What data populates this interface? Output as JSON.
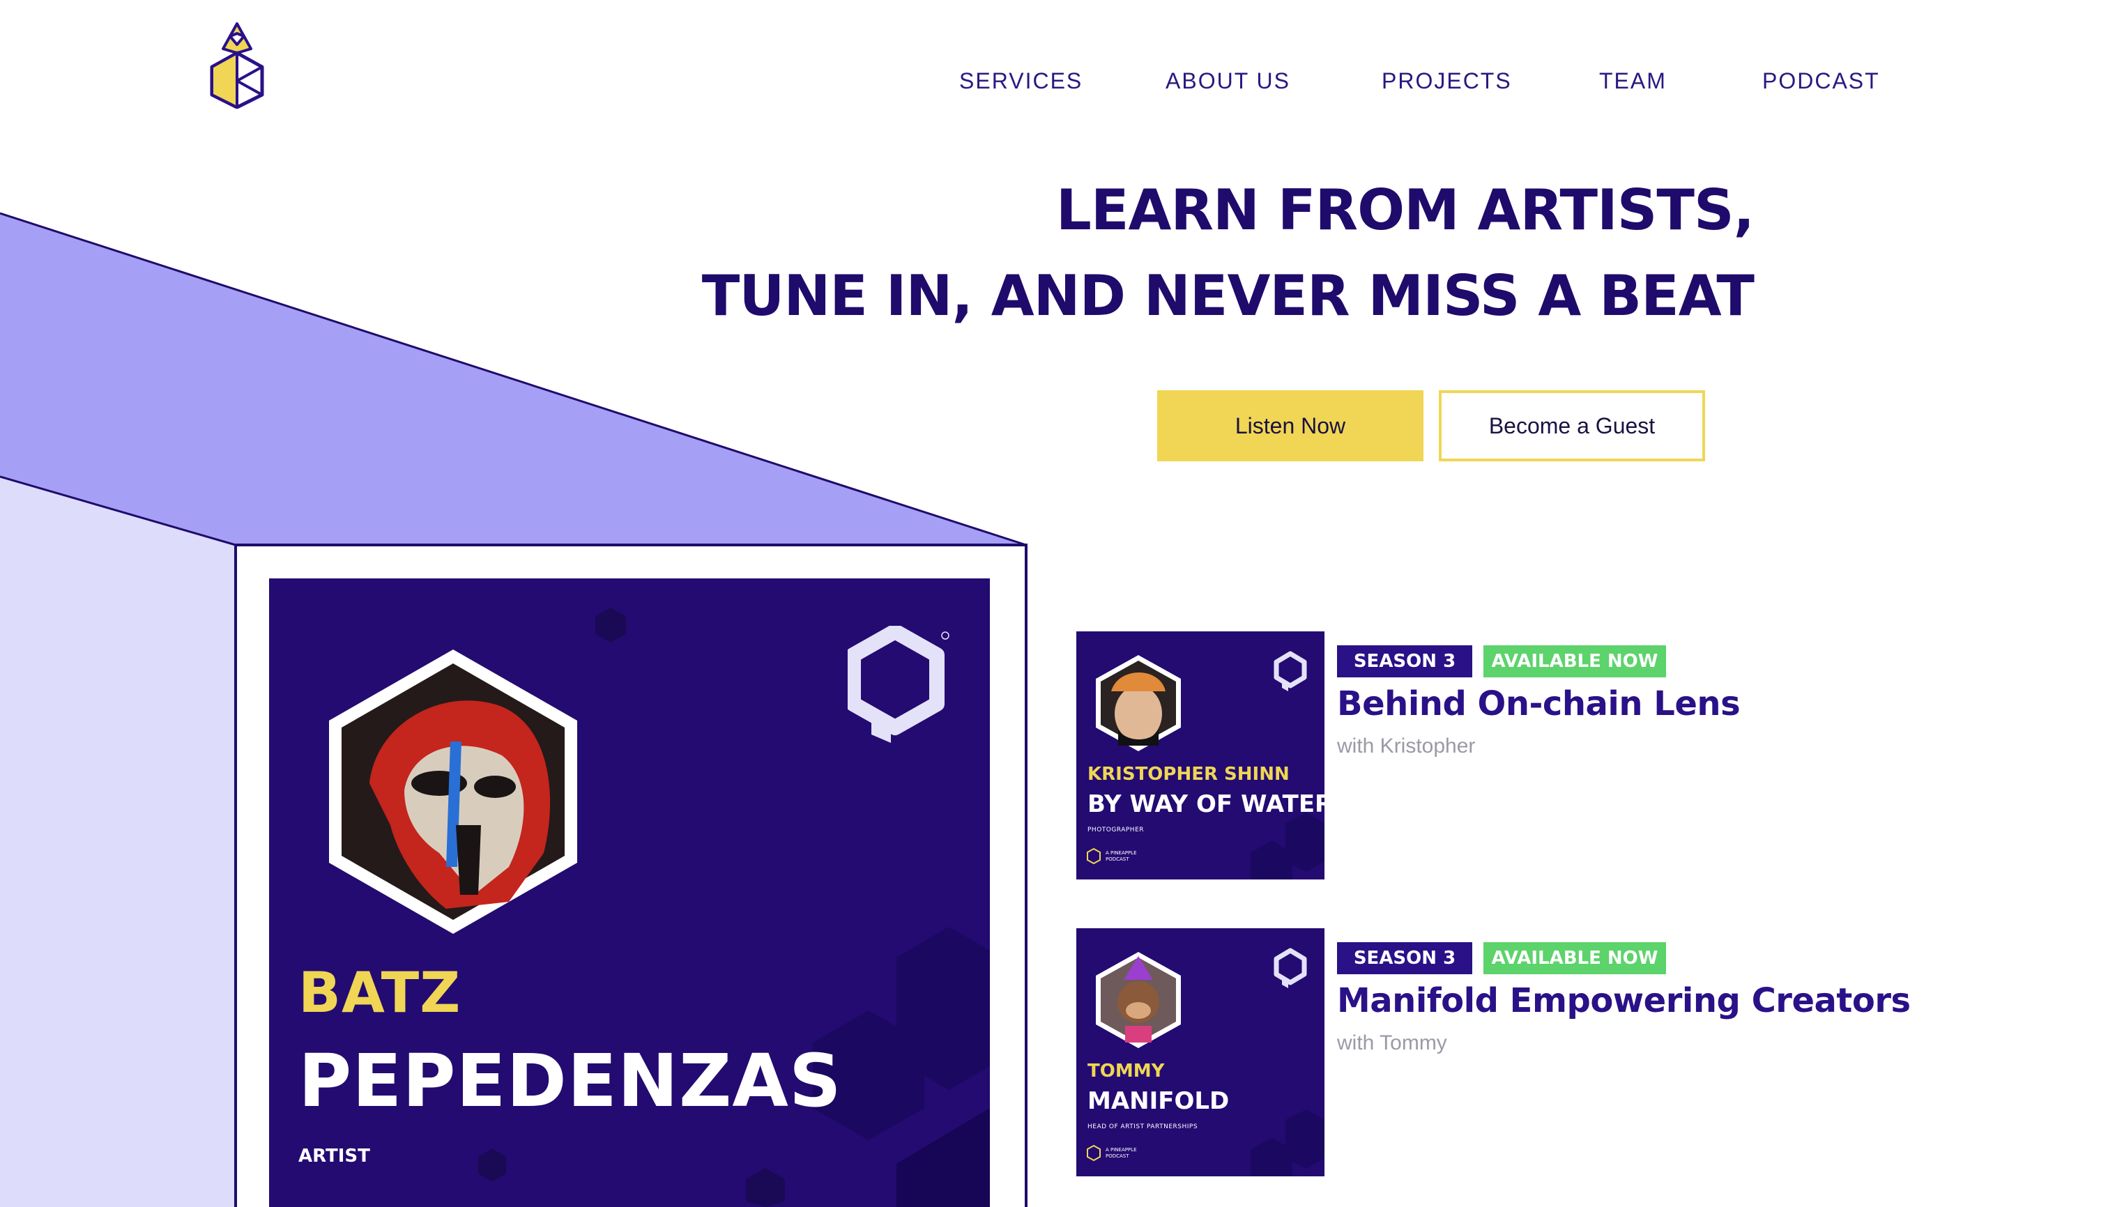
{
  "nav": {
    "items": [
      "SERVICES",
      "ABOUT US",
      "PROJECTS",
      "TEAM",
      "PODCAST"
    ]
  },
  "hero": {
    "line1_prefix": "LEARN FROM ",
    "line1_highlight": "ARTISTS,",
    "line2": "TUNE IN, AND NEVER MISS A BEAT",
    "primary_button": "Listen Now",
    "secondary_button": "Become a Guest"
  },
  "featured": {
    "first_name": "BATZ",
    "last_name": "PEPEDENZAS",
    "role": "ARTIST"
  },
  "episodes": [
    {
      "season": "SEASON 3",
      "status": "AVAILABLE NOW",
      "title": "Behind On-chain Lens",
      "guest": "with Kristopher",
      "thumb_first": "KRISTOPHER SHINN",
      "thumb_last": "BY WAY OF WATER",
      "thumb_role": "PHOTOGRAPHER",
      "thumb_brand": "A PINEAPPLE\nPODCAST"
    },
    {
      "season": "SEASON 3",
      "status": "AVAILABLE NOW",
      "title": "Manifold Empowering Creators",
      "guest": "with Tommy",
      "thumb_first": "TOMMY",
      "thumb_last": "MANIFOLD",
      "thumb_role": "HEAD OF ARTIST PARTNERSHIPS",
      "thumb_brand": "A PINEAPPLE\nPODCAST"
    }
  ],
  "colors": {
    "navy": "#1f0b6b",
    "cover_purple": "#230b72",
    "accent_yellow": "#f0d654",
    "lavender": "#a59ff5",
    "light_lavender": "#dddcfb",
    "available_green": "#5cd36b"
  }
}
